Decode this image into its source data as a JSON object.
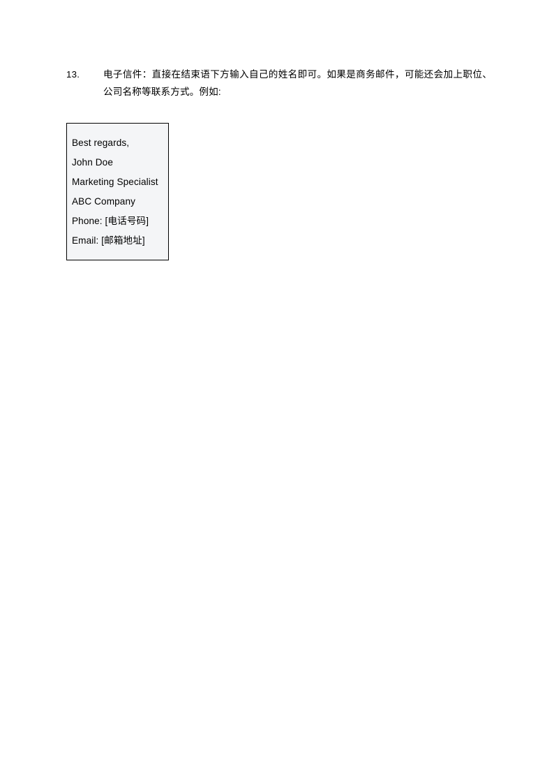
{
  "document": {
    "background_color": "#ffffff",
    "text_color": "#000000"
  },
  "list_item": {
    "marker": "13.",
    "paragraph": "电子信件：直接在结束语下方输入自己的姓名即可。如果是商务邮件，可能还会加上职位、公司名称等联系方式。例如:"
  },
  "signature_box": {
    "border_color": "#000000",
    "background_color": "#f4f5f7",
    "lines": [
      {
        "text": "Best regards,"
      },
      {
        "text": "John Doe"
      },
      {
        "text": "Marketing Specialist"
      },
      {
        "text": "ABC Company"
      },
      {
        "text": "Phone: [电话号码]"
      },
      {
        "text": "Email: [邮箱地址]"
      }
    ]
  }
}
